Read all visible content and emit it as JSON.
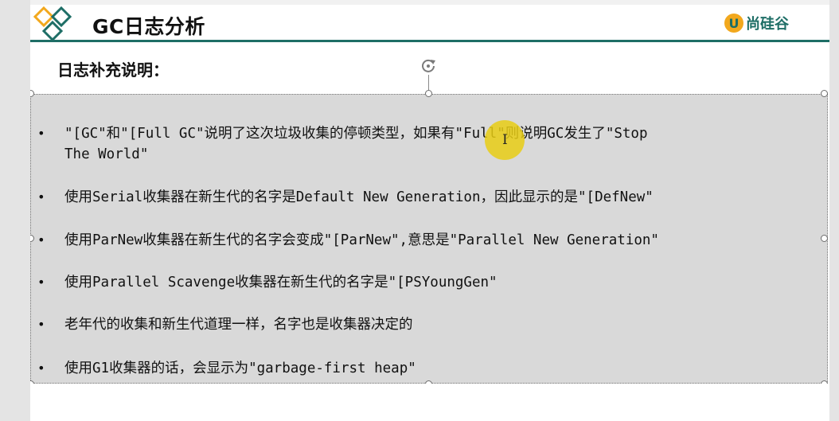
{
  "header": {
    "title": "GC日志分析",
    "brand_badge": "U",
    "brand_name": "尚硅谷"
  },
  "subtitle": "日志补充说明：",
  "bullet_symbol": "•",
  "bullets": [
    "\"[GC\"和\"[Full GC\"说明了这次垃圾收集的停顿类型，如果有\"Full\"则说明GC发生了\"Stop\nThe World\"",
    "使用Serial收集器在新生代的名字是Default New Generation，因此显示的是\"[DefNew\"",
    "使用ParNew收集器在新生代的名字会变成\"[ParNew\",意思是\"Parallel New Generation\"",
    "使用Parallel Scavenge收集器在新生代的名字是\"[PSYoungGen\"",
    "老年代的收集和新生代道理一样，名字也是收集器决定的",
    "使用G1收集器的话，会显示为\"garbage-first heap\""
  ],
  "cursor": {
    "glyph": "I"
  },
  "colors": {
    "accent_teal": "#1e6e66",
    "brand_orange": "#f2a81d",
    "highlight_yellow": "#e8cd14",
    "textbox_bg": "#d9d9d9"
  },
  "icons": {
    "logo": "diamond-logo-icon",
    "rotate": "rotate-handle-icon",
    "cursor": "text-cursor-icon"
  }
}
